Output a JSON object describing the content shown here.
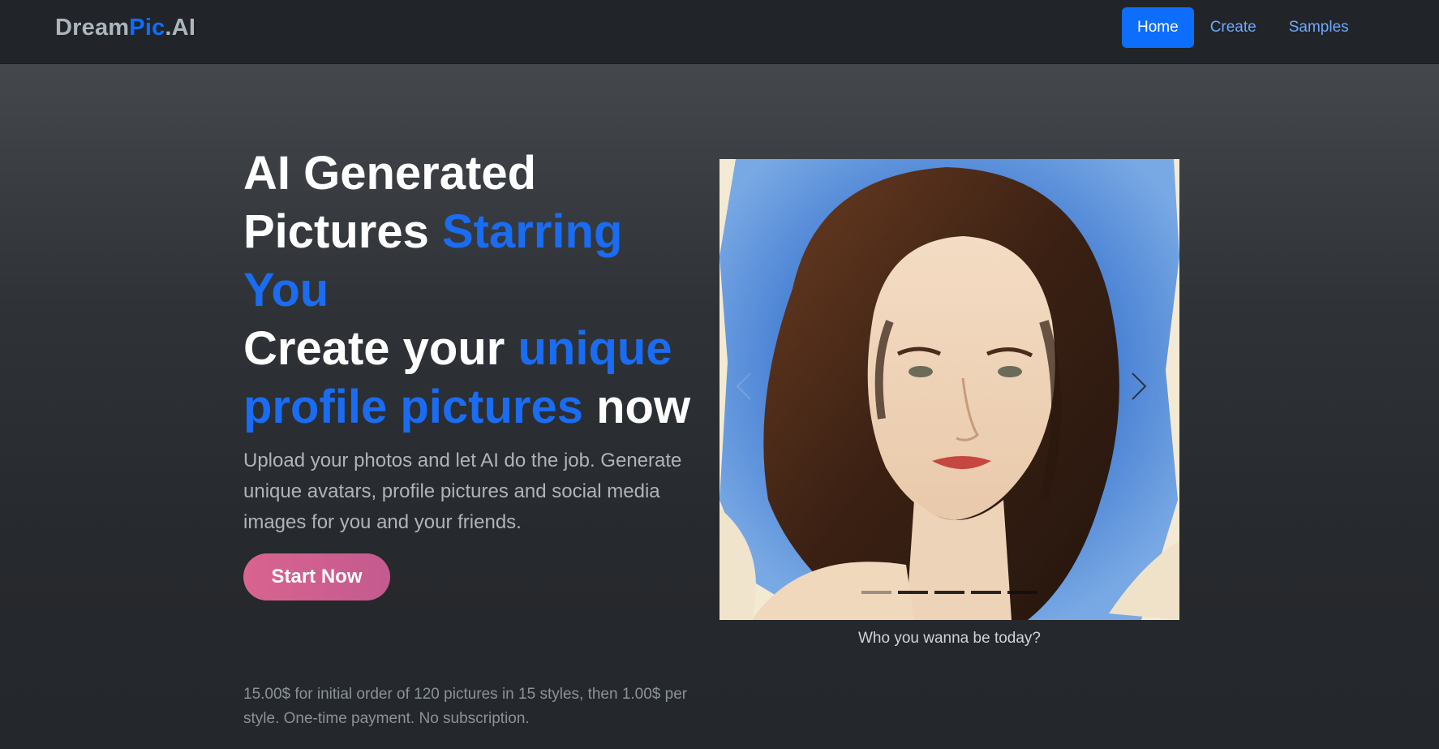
{
  "nav": {
    "brand_part1": "Dream",
    "brand_part2": "Pic",
    "brand_part3": ".AI",
    "links": [
      "Home",
      "Create",
      "Samples"
    ],
    "active": "Home"
  },
  "hero": {
    "headline": {
      "l1": "AI Generated",
      "l2_white": "Pictures ",
      "l2_blue": "Starring",
      "l3_blue": "You",
      "l4_white": "Create your ",
      "l4_blue": "unique",
      "l5_blue": "profile pictures",
      "l5_white": " now"
    },
    "lead": "Upload your photos and let AI do the job. Generate unique avatars, profile pictures and social media images for you and your friends.",
    "cta_label": "Start Now",
    "pricing": "15.00$ for initial order of 120 pictures in 15 styles, then 1.00$ per style. One-time payment. No subscription."
  },
  "carousel": {
    "slide_count": 5,
    "active_index": 0,
    "caption": "Who you wanna be today?",
    "image_alt": "watercolor-portrait-image"
  },
  "colors": {
    "accent": "#0d6efd",
    "cta": "#d8648f",
    "navbar": "#212529"
  }
}
